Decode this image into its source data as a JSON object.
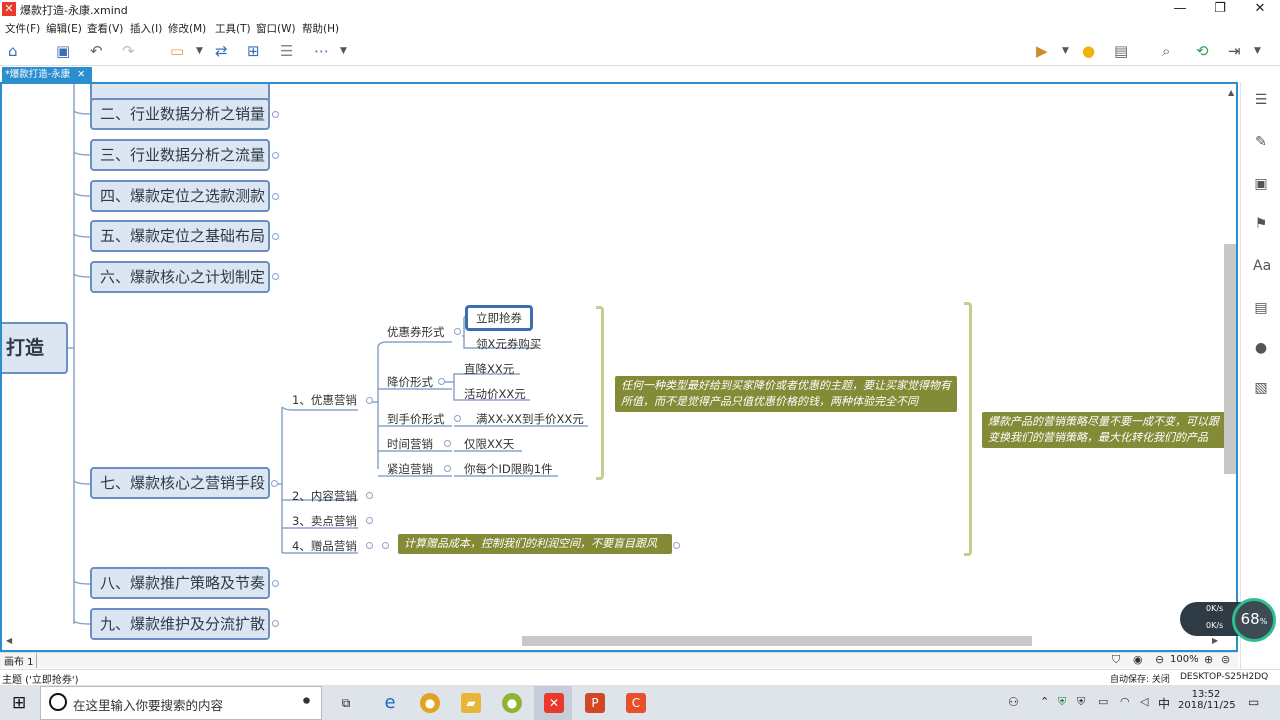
{
  "window": {
    "title": "爆款打造-永康.xmind",
    "app_icon": "xmind-icon",
    "min": "—",
    "max": "❐",
    "close": "✕"
  },
  "menu": [
    "文件(F)",
    "编辑(E)",
    "查看(V)",
    "插入(I)",
    "修改(M)",
    "工具(T)",
    "窗口(W)",
    "帮助(H)"
  ],
  "tab": {
    "label": "*爆款打造-永康",
    "close": "✕"
  },
  "root": {
    "label": "打造"
  },
  "topics": [
    "二、行业数据分析之销量",
    "三、行业数据分析之流量",
    "四、爆款定位之选款测款",
    "五、爆款定位之基础布局",
    "六、爆款核心之计划制定",
    "七、爆款核心之营销手段",
    "八、爆款推广策略及节奏",
    "九、爆款维护及分流扩散"
  ],
  "marketing": {
    "branches": [
      "1、优惠营销",
      "2、内容营销",
      "3、卖点营销",
      "4、赠品营销"
    ],
    "discount_groups": [
      "优惠券形式",
      "降价形式",
      "到手价形式",
      "时间营销",
      "紧迫营销"
    ],
    "leaves": {
      "coupon_selected": "立即抢券",
      "coupon_2": "领X元券购买",
      "price_cut_1": "直降XX元",
      "price_cut_2": "活动价XX元",
      "final_price": "满XX-XX到手价XX元",
      "time": "仅限XX天",
      "urgency": "你每个ID限购1件"
    },
    "notes": {
      "discount_note": "任何一种类型最好给到买家降价或者优惠的主题，要让买家觉得物有所值，而不是觉得产品只值优惠价格的钱，两种体验完全不同",
      "gift_note": "计算赠品成本，控制我们的利润空间，不要盲目跟风",
      "main_note": "爆款产品的营销策略尽量不要一成不变，可以跟变换我们的营销策略，最大化转化我们的产品"
    }
  },
  "statusbar": {
    "sheet": "画布 1",
    "zoom": "100%",
    "selection": "主题 ('立即抢券')",
    "autosave": "自动保存: 关闭",
    "machine": "DESKTOP-S25H2DQ"
  },
  "taskbar": {
    "search_placeholder": "在这里输入你要搜索的内容",
    "time": "13:52",
    "date": "2018/11/25",
    "ime": "中"
  },
  "netwidget": {
    "up": "0K/s",
    "down": "0K/s",
    "percent": "68",
    "unit": "%"
  },
  "colors": {
    "accent": "#2b8ecf",
    "topic_border": "#6b8fc4",
    "topic_fill": "#dce6f3",
    "note": "#848b37"
  }
}
